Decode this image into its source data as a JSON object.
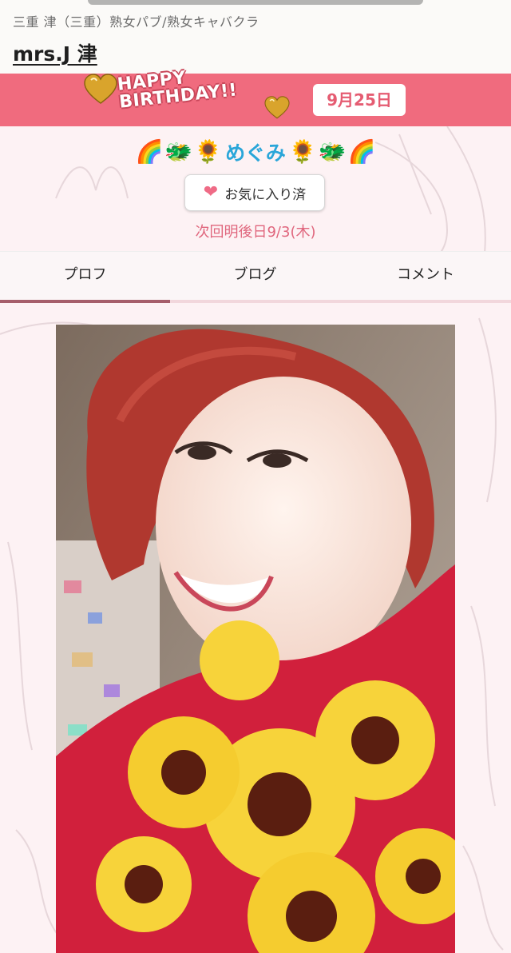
{
  "header": {
    "breadcrumb": "三重 津（三重）熟女パブ/熟女キャバクラ",
    "shop_name": "mrs.J 津"
  },
  "birthday_banner": {
    "line1": "HAPPY",
    "line2": "BIRTHDAY!!",
    "date": "9月25日"
  },
  "profile": {
    "name": "めぐみ",
    "emoji_left": [
      "🌈",
      "🐲",
      "🌻"
    ],
    "emoji_right": [
      "🌻",
      "🐲",
      "🌈"
    ],
    "favorite_label": "お気に入り済",
    "next_day": "次回明後日9/3(木)"
  },
  "tabs": [
    {
      "label": "プロフ",
      "active": true
    },
    {
      "label": "ブログ",
      "active": false
    },
    {
      "label": "コメント",
      "active": false
    }
  ],
  "colors": {
    "banner": "#f06b7e",
    "name": "#2aa6d9",
    "accent": "#e0667d",
    "active_tab": "#a65e6b"
  }
}
